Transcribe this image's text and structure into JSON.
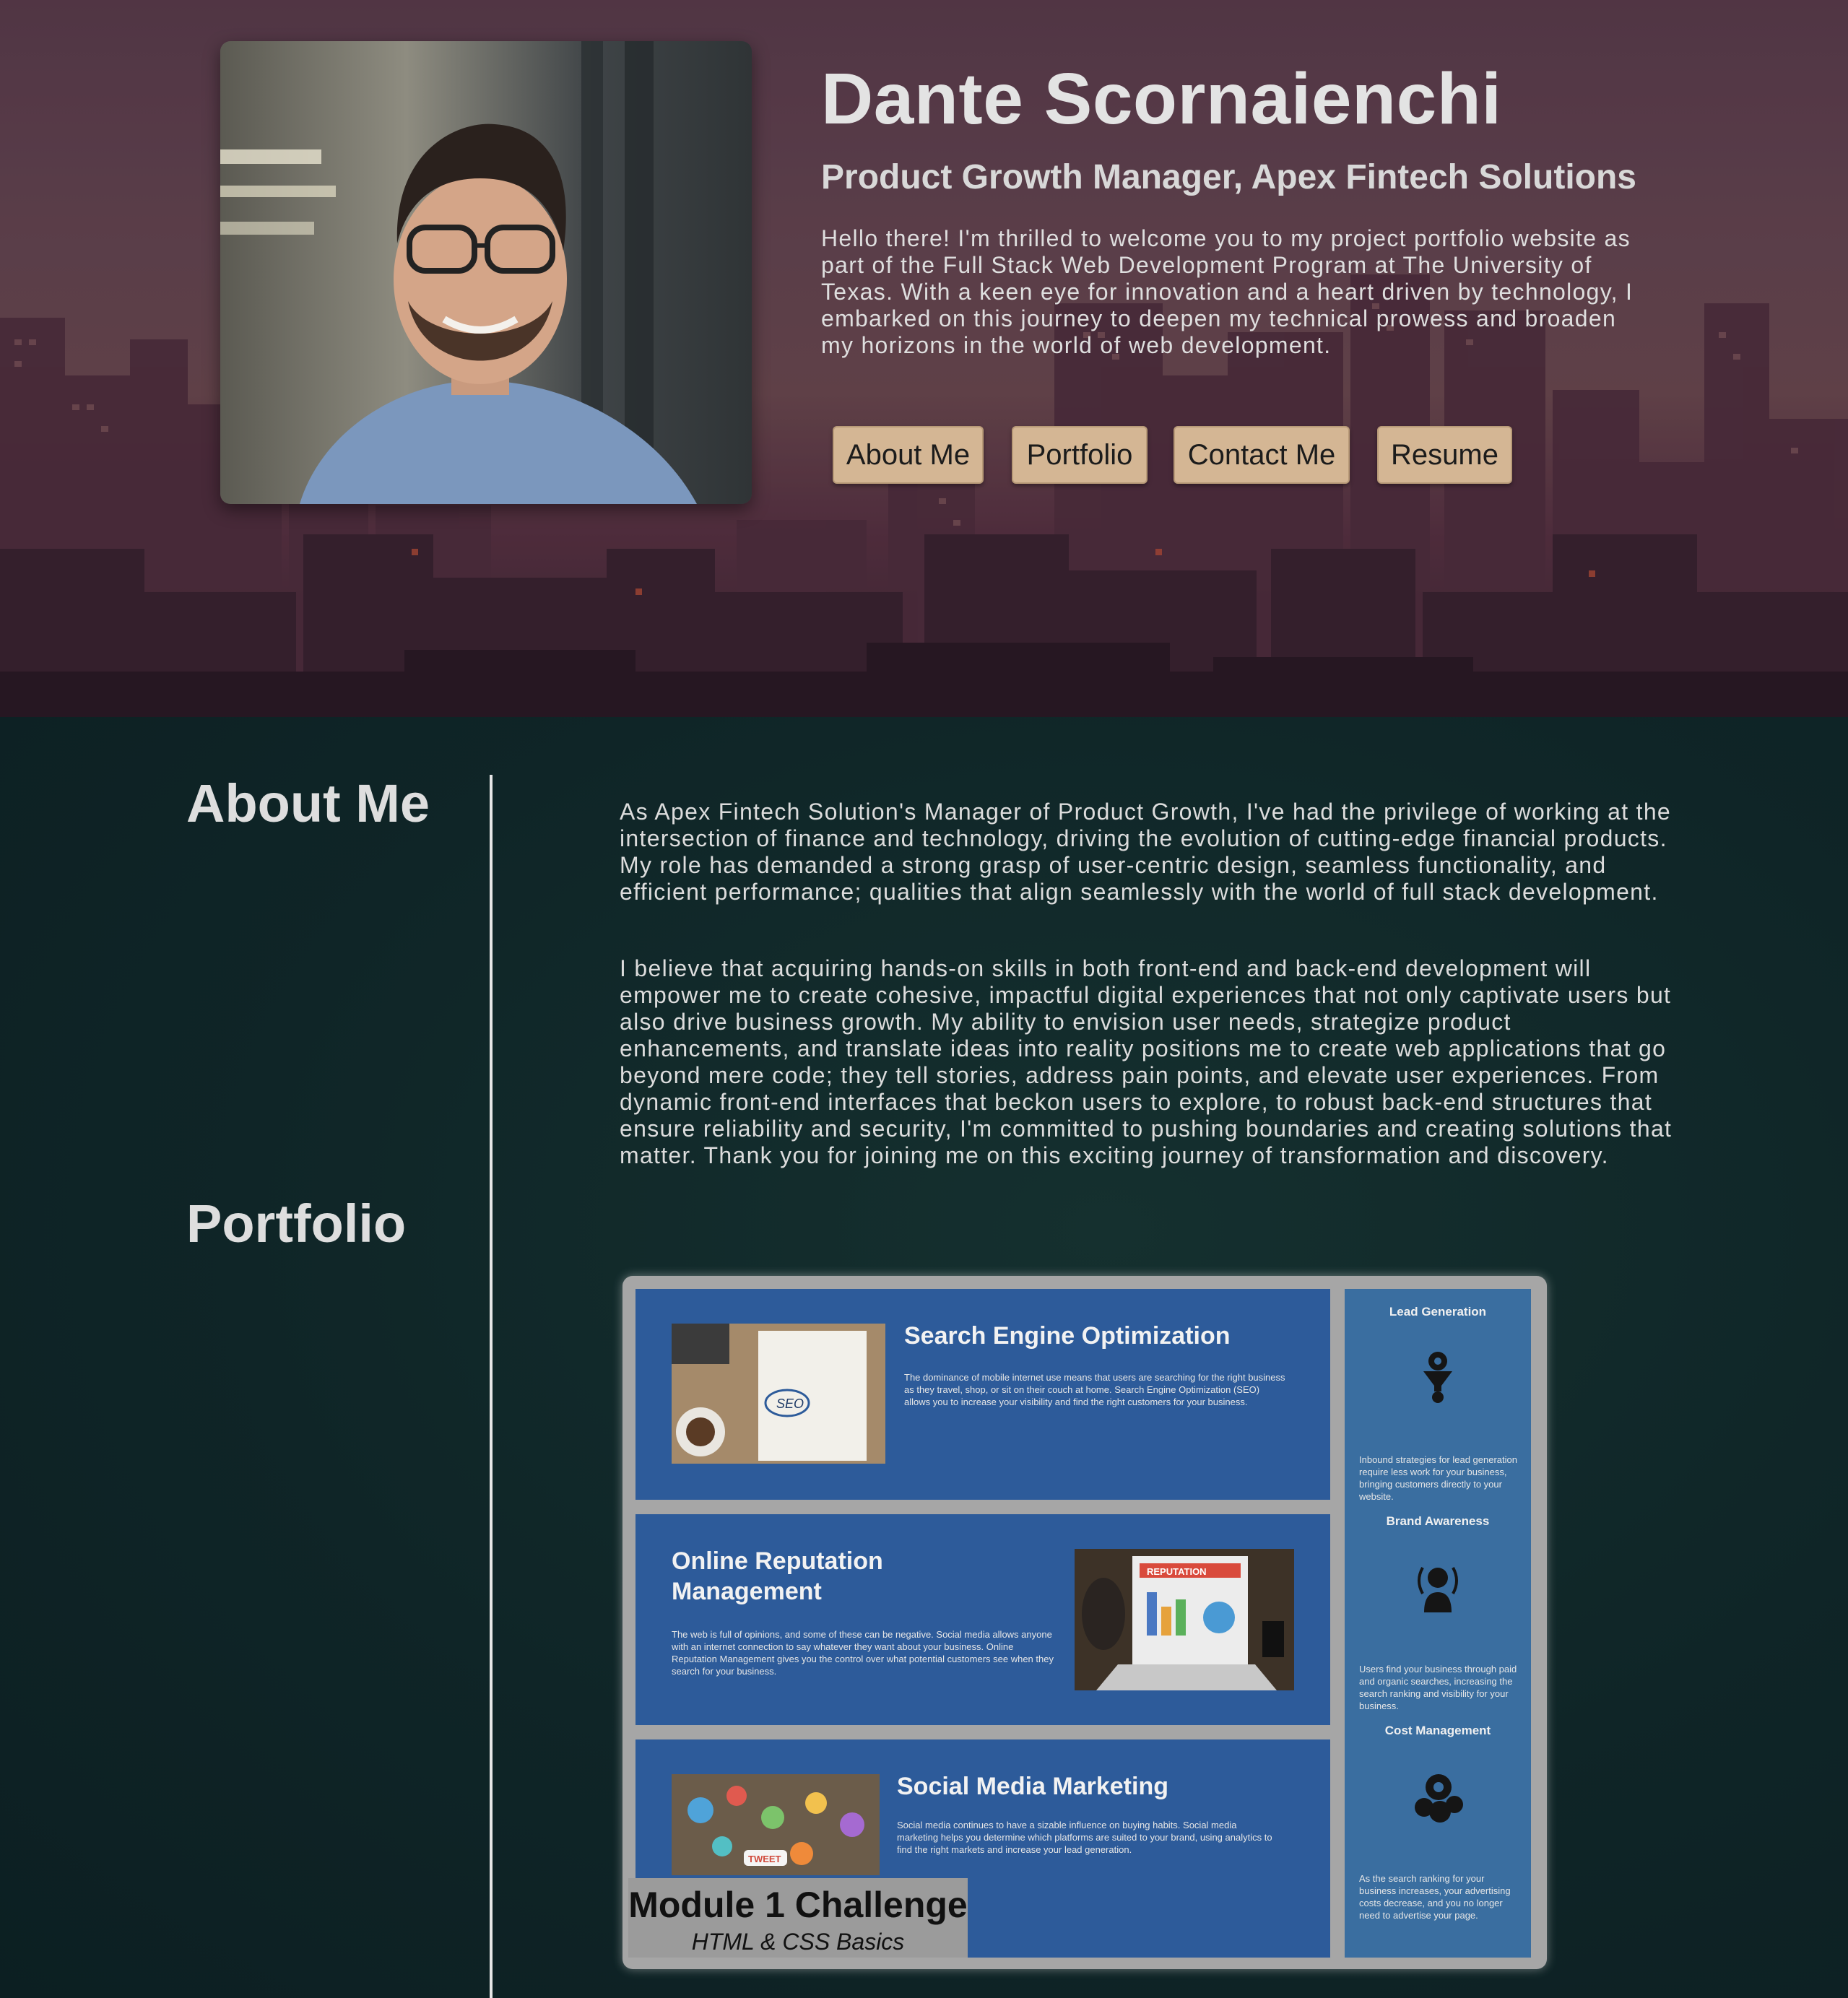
{
  "hero": {
    "name": "Dante Scornaienchi",
    "role": "Product Growth Manager, Apex Fintech Solutions",
    "intro": "Hello there! I'm thrilled to welcome you to my project portfolio website as part of the Full Stack Web Development Program at The University of Texas. With a keen eye for innovation and a heart driven by technology, I embarked on this journey to deepen my technical prowess and broaden my horizons in the world of web development."
  },
  "nav": {
    "about": "About Me",
    "portfolio": "Portfolio",
    "contact": "Contact Me",
    "resume": "Resume"
  },
  "about": {
    "title": "About Me",
    "paragraph1": "As Apex Fintech Solution's Manager of Product Growth, I've had the privilege of working at the intersection of finance and technology, driving the evolution of cutting-edge financial products. My role has demanded a strong grasp of user-centric design, seamless functionality, and efficient performance; qualities that align seamlessly with the world of full stack development.",
    "paragraph2": "I believe that acquiring hands-on skills in both front-end and back-end development will empower me to create cohesive, impactful digital experiences that not only captivate users but also drive business growth. My ability to envision user needs, strategize product enhancements, and translate ideas into reality positions me to create web applications that go beyond mere code; they tell stories, address pain points, and elevate user experiences. From dynamic front-end interfaces that beckon users to explore, to robust back-end structures that ensure reliability and security, I'm committed to pushing boundaries and creating solutions that matter. Thank you for joining me on this exciting journey of transformation and discovery."
  },
  "portfolio": {
    "title": "Portfolio",
    "project": {
      "title": "Module 1 Challenge",
      "subtitle": "HTML & CSS Basics",
      "panels": [
        {
          "title": "Search Engine Optimization",
          "text": "The dominance of mobile internet use means that users are searching for the right business as they travel, shop, or sit on their couch at home. Search Engine Optimization (SEO) allows you to increase your visibility and find the right customers for your business."
        },
        {
          "title": "Online Reputation Management",
          "text": "The web is full of opinions, and some of these can be negative. Social media allows anyone with an internet connection to say whatever they want about your business. Online Reputation Management gives you the control over what potential customers see when they search for your business."
        },
        {
          "title": "Social Media Marketing",
          "text": "Social media continues to have a sizable influence on buying habits. Social media marketing helps you determine which platforms are suited to your brand, using analytics to find the right markets and increase your lead generation."
        }
      ],
      "sidebar": [
        {
          "heading": "Lead Generation",
          "text": "Inbound strategies for lead generation require less work for your business, bringing customers directly to your website."
        },
        {
          "heading": "Brand Awareness",
          "text": "Users find your business through paid and organic searches, increasing the search ranking and visibility for your business."
        },
        {
          "heading": "Cost Management",
          "text": "As the search ranking for your business increases, your advertising costs decrease, and you no longer need to advertise your page."
        }
      ],
      "image_tags": {
        "seo": "SEO",
        "reputation": "REPUTATION",
        "tweet": "TWEET"
      }
    }
  }
}
